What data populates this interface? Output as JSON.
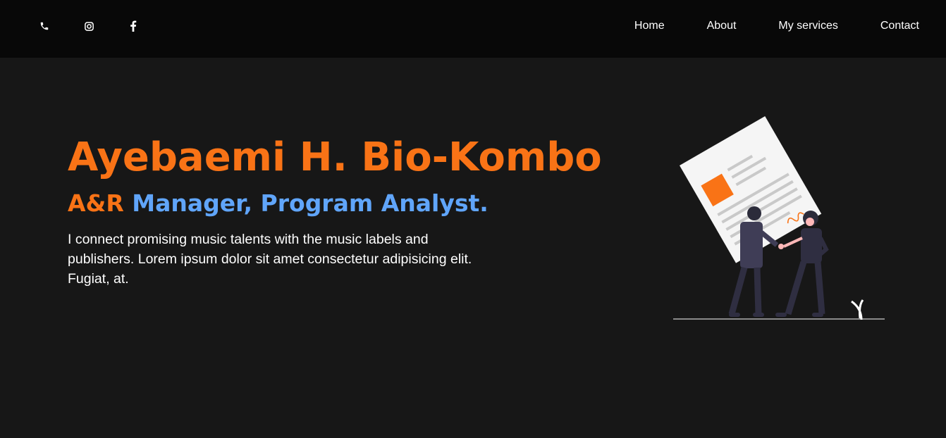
{
  "header": {
    "socials": [
      {
        "name": "phone-icon"
      },
      {
        "name": "instagram-icon"
      },
      {
        "name": "facebook-icon"
      }
    ],
    "nav": [
      {
        "label": "Home"
      },
      {
        "label": "About"
      },
      {
        "label": "My services"
      },
      {
        "label": "Contact"
      }
    ]
  },
  "hero": {
    "name": "Ayebaemi H. Bio-Kombo",
    "role_accent": "A&R",
    "role_rest": "Manager, Program Analyst.",
    "description": "I connect promising music talents with the music labels and publishers. Lorem ipsum dolor sit amet consectetur adipisicing elit. Fugiat, at."
  },
  "colors": {
    "background": "#171717",
    "header_bg": "#080808",
    "accent_orange": "#f97316",
    "accent_blue": "#60a5fa",
    "text": "#ffffff"
  },
  "illustration": {
    "icon": "agreement-handshake-illustration"
  }
}
